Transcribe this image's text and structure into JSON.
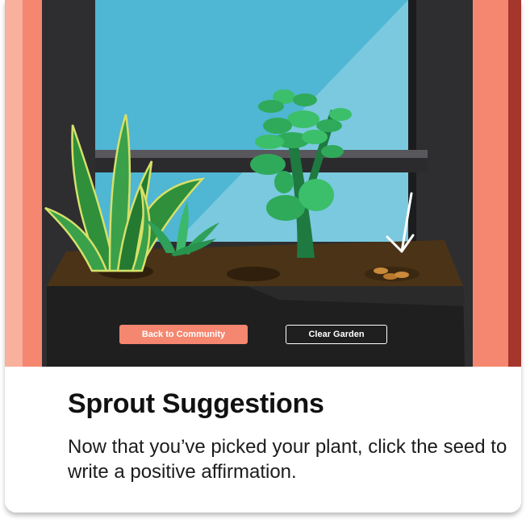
{
  "scene": {
    "seed_icon": "seed-icon",
    "arrow_icon": "arrow-down-icon"
  },
  "buttons": {
    "back_label": "Back to Community",
    "clear_label": "Clear Garden"
  },
  "caption": {
    "title": "Sprout Suggestions",
    "description": "Now that you’ve picked your plant, click the seed to write a positive affirmation."
  },
  "colors": {
    "accent": "#f5866f",
    "dark": "#2e2e30",
    "soil": "#4a3316",
    "sky": "#4fb6d3"
  }
}
